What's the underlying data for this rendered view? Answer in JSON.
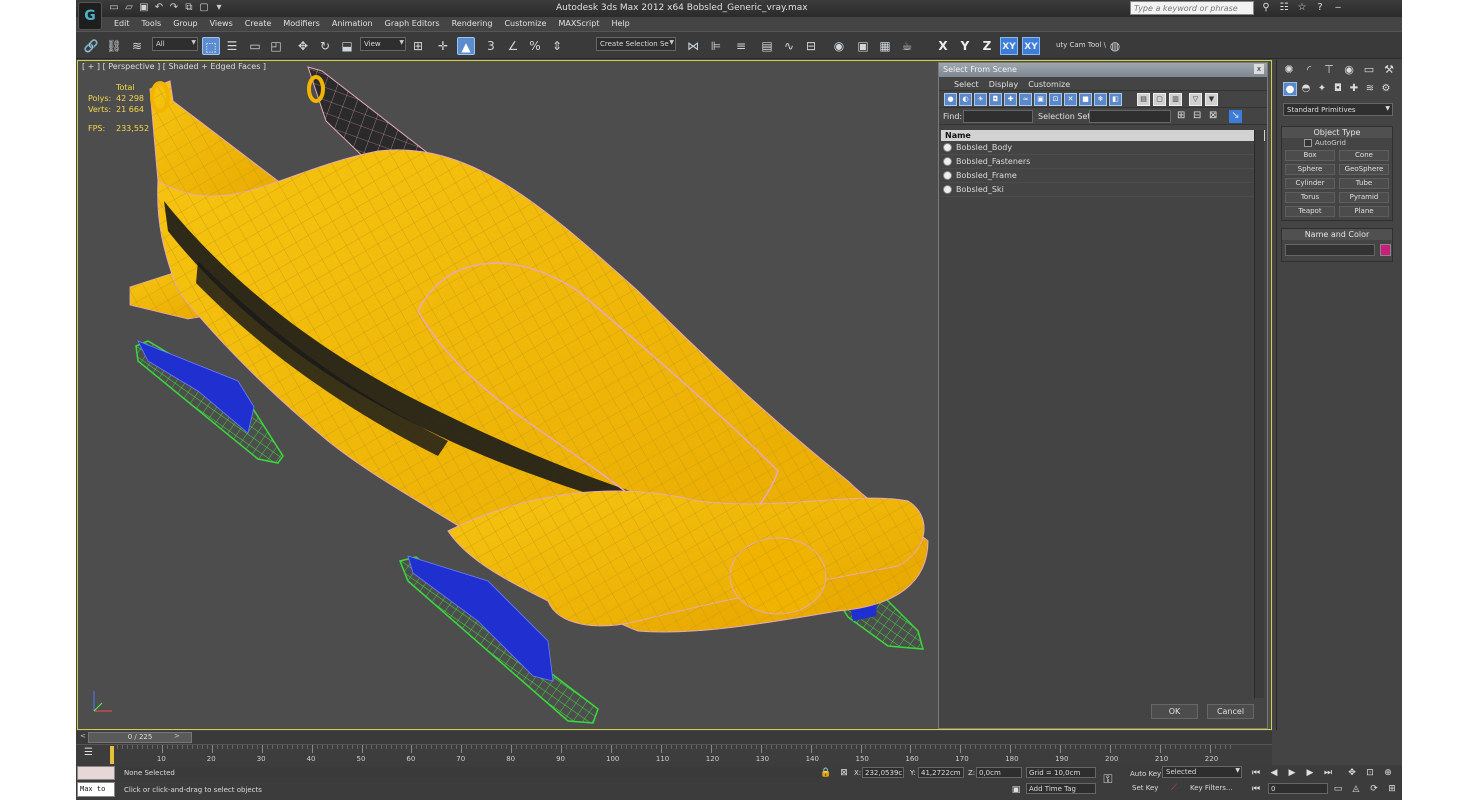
{
  "app": {
    "title": "Autodesk 3ds Max  2012 x64      Bobsled_Generic_vray.max",
    "search_placeholder": "Type a keyword or phrase",
    "logo": "3ds-max-logo"
  },
  "menu": [
    "Edit",
    "Tools",
    "Group",
    "Views",
    "Create",
    "Modifiers",
    "Animation",
    "Graph Editors",
    "Rendering",
    "Customize",
    "MAXScript",
    "Help"
  ],
  "toolbar": {
    "selection_filter": "All",
    "ref_coord": "View",
    "named_selection": "Create Selection Se",
    "axes": [
      "X",
      "Y",
      "Z",
      "XY",
      "XY"
    ],
    "util_label": "uty Cam Tool \\"
  },
  "viewport": {
    "label": "[ + ] [ Perspective ] [ Shaded + Edged Faces ]",
    "stats": {
      "total_label": "Total",
      "polys_label": "Polys:",
      "polys": "42 298",
      "verts_label": "Verts:",
      "verts": "21 664",
      "fps_label": "FPS:",
      "fps": "233,552"
    },
    "colors": {
      "body": "#f2b400",
      "stripe": "#1a1a1a",
      "runner_blue": "#1f2fd0",
      "ski_green": "#3bd83b",
      "wire": "#e8a9b8"
    }
  },
  "scene_dialog": {
    "title": "Select From Scene",
    "close": "x",
    "menu": [
      "Select",
      "Display",
      "Customize"
    ],
    "find_label": "Find:",
    "selection_set_label": "Selection Set:",
    "column_header": "Name",
    "items": [
      "Bobsled_Body",
      "Bobsled_Fasteners",
      "Bobsled_Frame",
      "Bobsled_Ski"
    ],
    "ok": "OK",
    "cancel": "Cancel"
  },
  "command_panel": {
    "category": "Standard Primitives",
    "object_type_title": "Object Type",
    "autogrid": "AutoGrid",
    "primitives": [
      "Box",
      "Cone",
      "Sphere",
      "GeoSphere",
      "Cylinder",
      "Tube",
      "Torus",
      "Pyramid",
      "Teapot",
      "Plane"
    ],
    "name_color_title": "Name and Color",
    "swatch_color": "#c8207a"
  },
  "timeline": {
    "frame": "0 / 225",
    "prev": "<",
    "next": ">",
    "ticks": [
      "10",
      "20",
      "30",
      "40",
      "50",
      "60",
      "70",
      "80",
      "90",
      "100",
      "110",
      "120",
      "130",
      "140",
      "150",
      "160",
      "170",
      "180",
      "190",
      "200",
      "210",
      "220"
    ]
  },
  "status": {
    "maxscript_label": "Max to",
    "selection": "None Selected",
    "prompt": "Click or click-and-drag to select objects",
    "x_label": "X:",
    "x": "232,0539c",
    "y_label": "Y:",
    "y": "41,2722cm",
    "z_label": "Z:",
    "z": "0,0cm",
    "grid": "Grid = 10,0cm",
    "add_time_tag": "Add Time Tag",
    "auto_key": "Auto Key",
    "set_key": "Set Key",
    "key_mode": "Selected",
    "key_filters": "Key Filters...",
    "frame_field": "0"
  }
}
